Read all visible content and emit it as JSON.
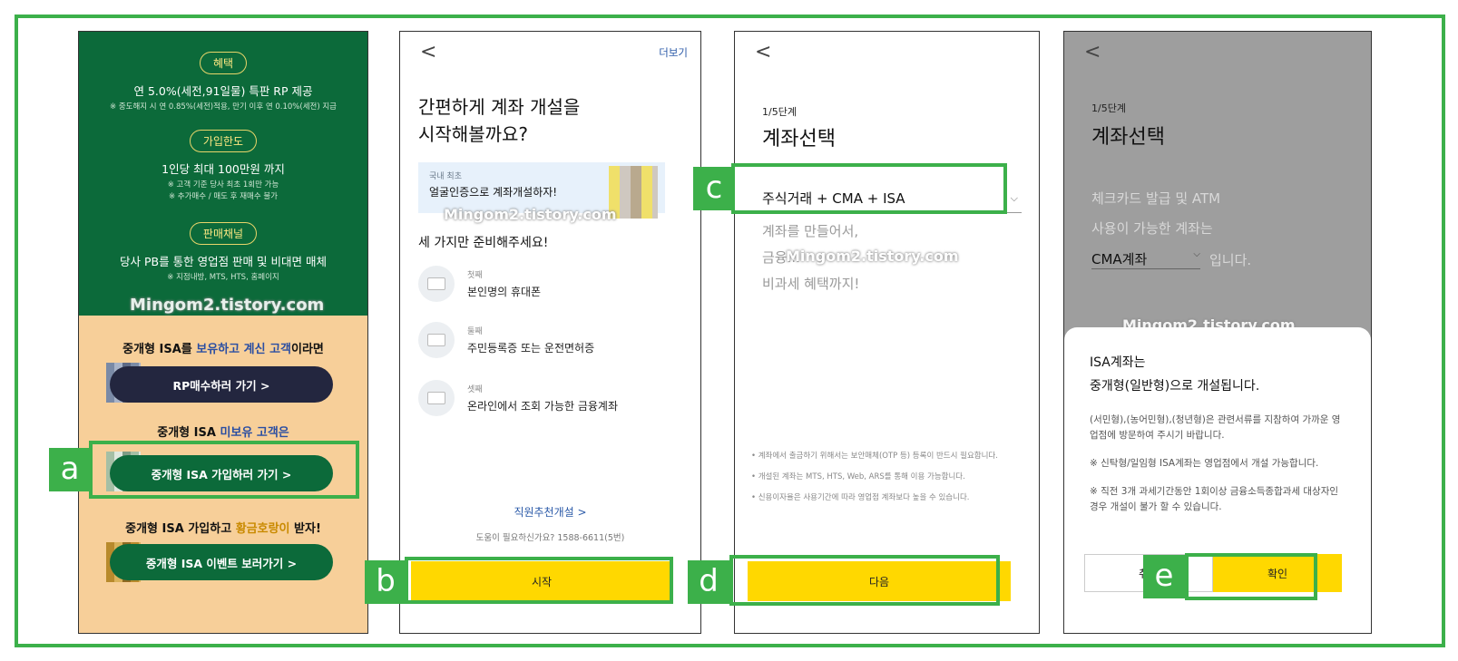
{
  "panel1": {
    "benefit_pill": "혜택",
    "benefit_main": "연 5.0%(세전,91일물) 특판 RP 제공",
    "benefit_note": "※ 중도해지 시 연 0.85%(세전)적용, 만기 이후 연 0.10%(세전) 지급",
    "limit_pill": "가입한도",
    "limit_main": "1인당 최대 100만원 까지",
    "limit_note1": "※ 고객 기준 당사 최초 1회만 가능",
    "limit_note2": "※ 추가매수 / 매도 후 재매수 불가",
    "channel_pill": "판매채널",
    "channel_main": "당사 PB를 통한 영업점 판매 및 비대면 매체",
    "channel_note": "※ 지점내방, MTS, HTS, 홈페이지",
    "watermark": "Mingom2.tistory.com",
    "holder_pre": "중개형 ISA를 ",
    "holder_hl": "보유하고 계신 고객",
    "holder_post": "이라면",
    "rp_button": "RP매수하러 가기 >",
    "nonholder_pre": "중개형 ISA ",
    "nonholder_hl": "미보유 고객은",
    "join_button": "중개형 ISA 가입하러 가기 >",
    "event_pre": "중개형 ISA 가입하고 ",
    "event_hl": "황금호랑이",
    "event_post": " 받자!",
    "event_button": "중개형 ISA 이벤트 보러가기 >"
  },
  "panel2": {
    "back": "<",
    "more": "더보기",
    "title_line1": "간편하게 계좌 개설을",
    "title_line2": "시작해볼까요?",
    "banner_small": "국내 최초",
    "banner_big": "얼굴인증으로 계좌개설하자!",
    "watermark": "Mingom2.tistory.com",
    "subtitle": "세 가지만 준비해주세요!",
    "requirements": [
      {
        "ord": "첫째",
        "label": "본인명의 휴대폰"
      },
      {
        "ord": "둘째",
        "label": "주민등록증 또는 운전면허증"
      },
      {
        "ord": "셋째",
        "label": "온라인에서 조회 가능한 금융계좌"
      }
    ],
    "referral_link": "직원추천개설 >",
    "help": "도움이 필요하신가요? 1588-6611(5번)",
    "start_button": "시작"
  },
  "panel3": {
    "back": "<",
    "step": "1/5단계",
    "title": "계좌선택",
    "selected_account": "주식거래 + CMA + ISA",
    "desc_line1": "계좌를 만들어서,",
    "desc_line2": "금융...",
    "desc_line3": "비과세 혜택까지!",
    "watermark": "Mingom2.tistory.com",
    "note1": "• 계좌에서 출금하기 위해서는 보안매체(OTP 등) 등록이 반드시 필요합니다.",
    "note2": "• 개설된 계좌는 MTS, HTS, Web, ARS를 통해 이용 가능합니다.",
    "note3": "• 신용이자율은 사용기간에 따라 영업점 계좌보다 높을 수 있습니다.",
    "next_button": "다음"
  },
  "panel4": {
    "back": "<",
    "step": "1/5단계",
    "title": "계좌선택",
    "desc_line1": "체크카드 발급 및 ATM",
    "desc_line2": "사용이 가능한 계좌는",
    "selected_account": "CMA계좌",
    "desc_suffix": "입니다.",
    "watermark": "Mingom2.tistory.com",
    "sheet_title1": "ISA계좌는",
    "sheet_title2": "중개형(일반형)으로 개설됩니다.",
    "sheet_p1": "(서민형),(농어민형),(청년형)은 관련서류를 지참하여 가까운 영업점에 방문하여 주시기 바랍니다.",
    "sheet_p2": "※ 신탁형/일임형 ISA계좌는 영업점에서 개설 가능합니다.",
    "sheet_p3": "※ 직전 3개 과세기간동안 1회이상 금융소득종합과세 대상자인 경우 개설이 불가 할 수 있습니다.",
    "cancel_button": "취소",
    "confirm_button": "확인"
  },
  "markers": {
    "a": "a",
    "b": "b",
    "c": "c",
    "d": "d",
    "e": "e"
  },
  "colors": {
    "frame_green": "#3cb04a",
    "brand_green": "#0c6a3a",
    "beige": "#f7cf99",
    "yellow": "#ffd800",
    "link_blue": "#2b5aa8"
  }
}
